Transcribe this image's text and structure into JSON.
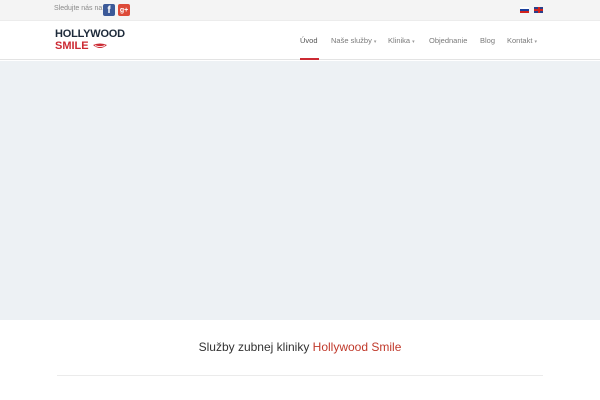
{
  "topbar": {
    "follow_label": "Sledujte nás na:",
    "social": [
      {
        "name": "facebook",
        "glyph": "f",
        "color": "#3b5998"
      },
      {
        "name": "google-plus",
        "glyph": "g+",
        "color": "#dd4b39"
      }
    ],
    "languages": [
      {
        "code": "sk",
        "icon": "slovak-flag-icon"
      },
      {
        "code": "en",
        "icon": "uk-flag-icon"
      }
    ]
  },
  "logo": {
    "line1": "HOLLYWOOD",
    "line2": "SMILE",
    "accent_color": "#cc2a33"
  },
  "nav": {
    "items": [
      {
        "label": "Úvod",
        "active": true
      },
      {
        "label": "Naše služby",
        "dropdown": true
      },
      {
        "label": "Klinika",
        "dropdown": true
      },
      {
        "label": "Objednanie"
      },
      {
        "label": "Blog"
      },
      {
        "label": "Kontakt",
        "dropdown": true
      }
    ],
    "caret": "▾"
  },
  "section": {
    "title_prefix": "Služby zubnej kliniky ",
    "title_accent": "Hollywood Smile"
  }
}
